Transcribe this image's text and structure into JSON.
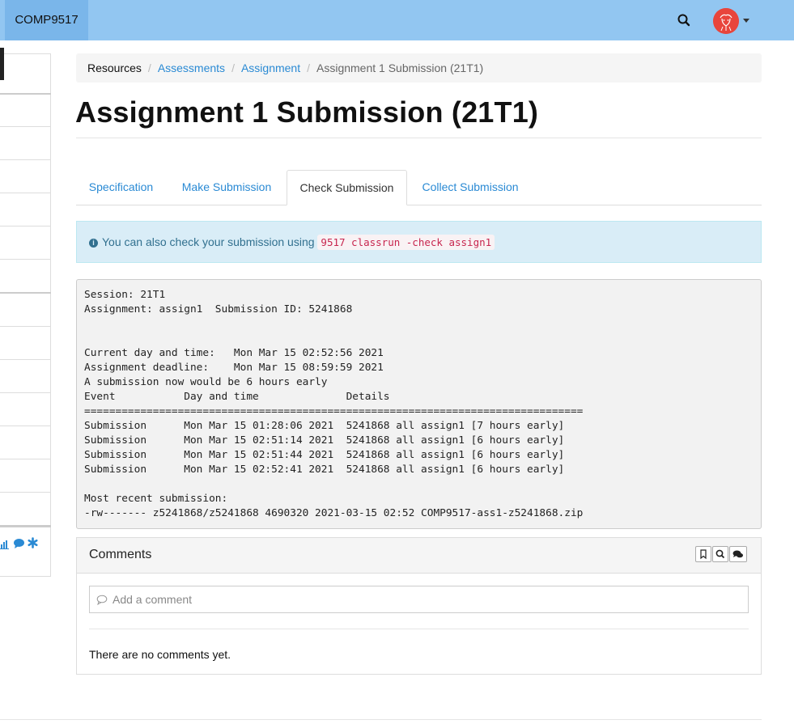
{
  "navbar": {
    "course": "COMP9517",
    "search_icon": "search-icon",
    "avatar_icon": "user-avatar",
    "caret_icon": "caret-down-icon"
  },
  "breadcrumb": {
    "items": [
      "Resources",
      "Assessments",
      "Assignment",
      "Assignment 1 Submission (21T1)"
    ],
    "separator": "/"
  },
  "page": {
    "title": "Assignment 1 Submission (21T1)"
  },
  "tabs": [
    "Specification",
    "Make Submission",
    "Check Submission",
    "Collect Submission"
  ],
  "active_tab": "Check Submission",
  "alert": {
    "text": "You can also check your submission using",
    "command": "9517 classrun -check assign1",
    "icon": "info-circle-icon"
  },
  "output": {
    "lines": [
      "Session: 21T1",
      "Assignment: assign1  Submission ID: 5241868",
      "",
      "",
      "Current day and time:   Mon Mar 15 02:52:56 2021",
      "Assignment deadline:    Mon Mar 15 08:59:59 2021",
      "A submission now would be 6 hours early",
      "Event           Day and time              Details",
      "================================================================================",
      "Submission      Mon Mar 15 01:28:06 2021  5241868 all assign1 [7 hours early]",
      "Submission      Mon Mar 15 02:51:14 2021  5241868 all assign1 [6 hours early]",
      "Submission      Mon Mar 15 02:51:44 2021  5241868 all assign1 [6 hours early]",
      "Submission      Mon Mar 15 02:52:41 2021  5241868 all assign1 [6 hours early]",
      "",
      "Most recent submission:",
      "-rw------- z5241868/z5241868 4690320 2021-03-15 02:52 COMP9517-ass1-z5241868.zip"
    ]
  },
  "comments": {
    "title": "Comments",
    "placeholder": "Add a comment",
    "empty_text": "There are no comments yet.",
    "buttons": [
      "bookmark-icon",
      "search-icon",
      "comments-icon"
    ]
  },
  "sidebar": {
    "icons": [
      "bar-chart-icon",
      "comment-icon",
      "asterisk-icon"
    ]
  },
  "colors": {
    "navbar": "#92c6f1",
    "brand": "#7ab6ea",
    "link": "#2a8ad4",
    "alert_bg": "#d9edf7",
    "code_text": "#c7254e"
  }
}
